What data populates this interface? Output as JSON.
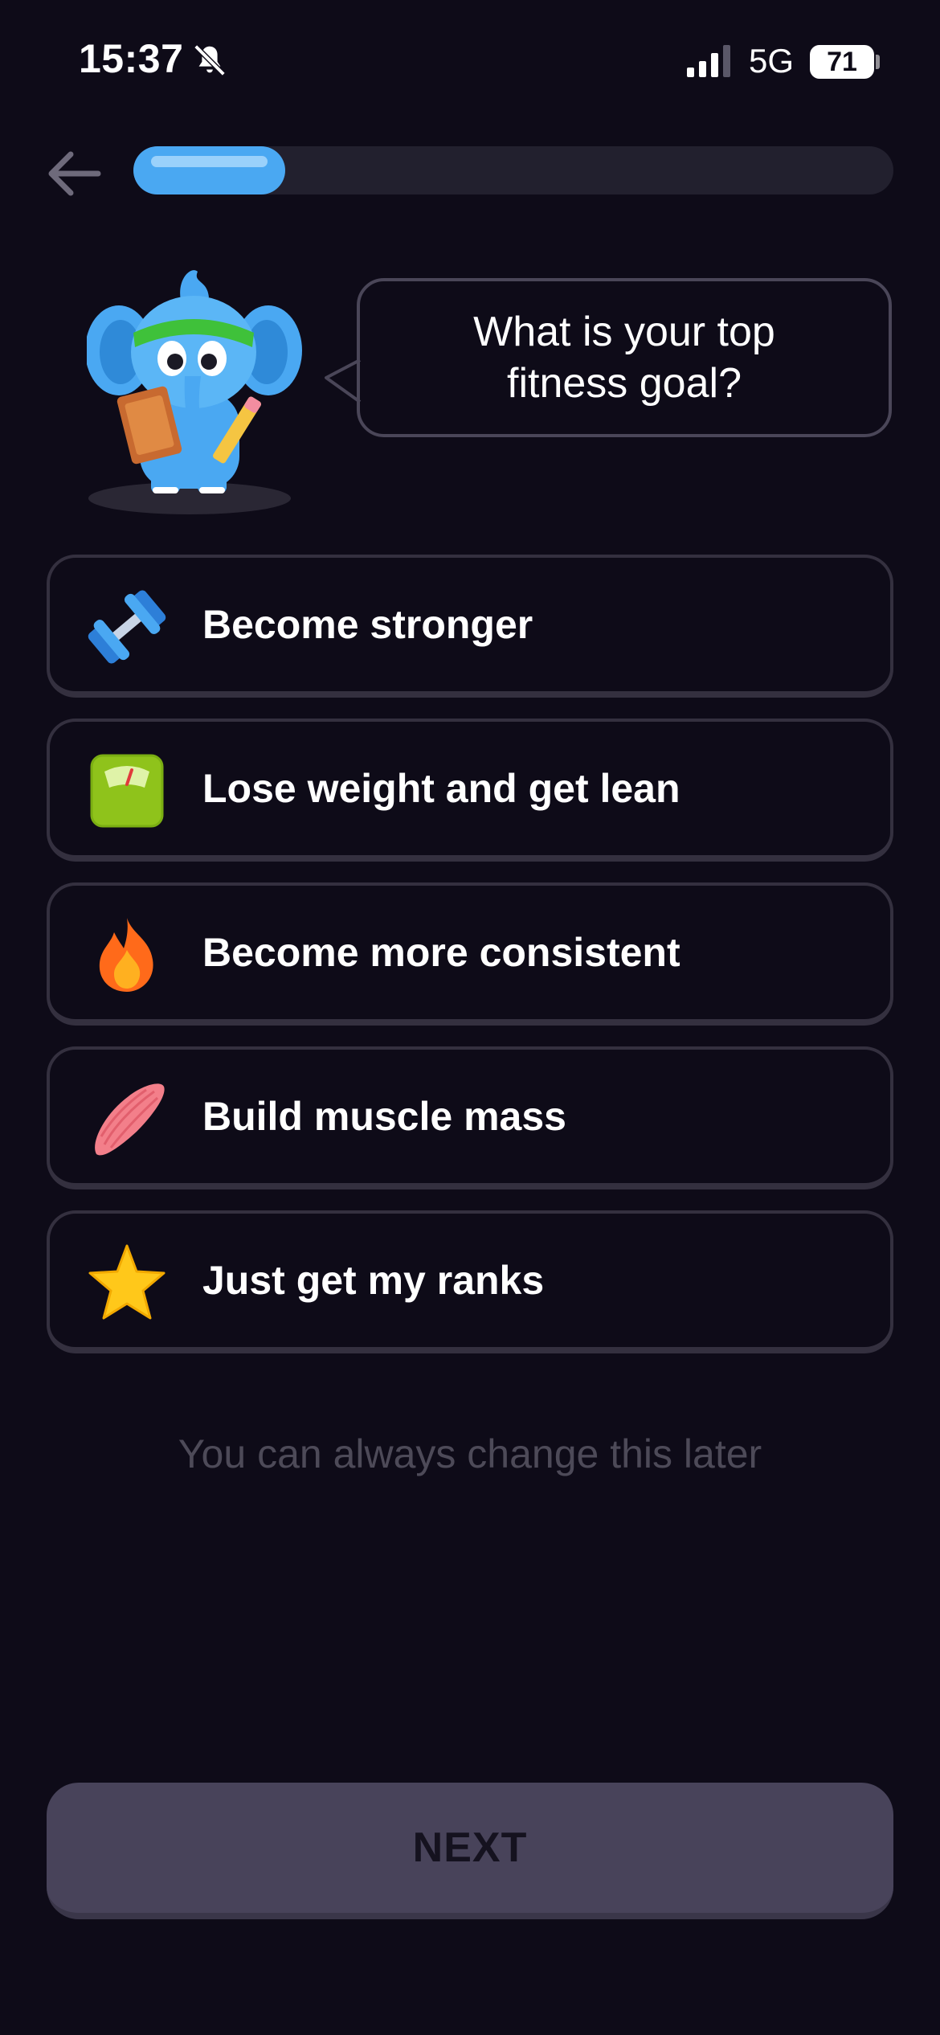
{
  "status_bar": {
    "time": "15:37",
    "network": "5G",
    "battery_level": "71"
  },
  "progress": {
    "value": 0.2
  },
  "question": "What is your top fitness goal?",
  "options": [
    {
      "label": "Become stronger",
      "icon": "dumbbell-icon"
    },
    {
      "label": "Lose weight and get lean",
      "icon": "scale-icon"
    },
    {
      "label": "Become more consistent",
      "icon": "fire-icon"
    },
    {
      "label": "Build muscle mass",
      "icon": "muscle-icon"
    },
    {
      "label": "Just get my ranks",
      "icon": "star-icon"
    }
  ],
  "hint": "You can always change this later",
  "next_label": "NEXT",
  "colors": {
    "background": "#0e0b18",
    "accent": "#4aa8f2",
    "option_border": "#34303f",
    "button_disabled": "#48435a"
  }
}
